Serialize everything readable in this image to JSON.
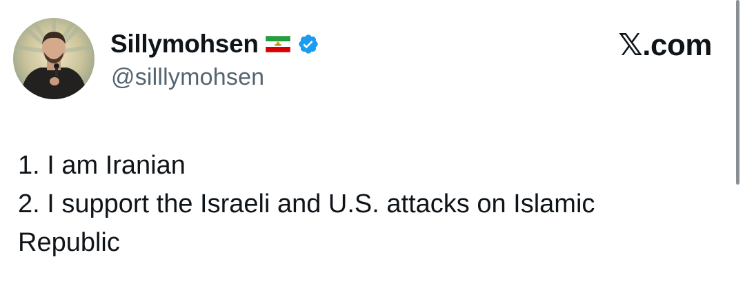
{
  "author": {
    "display_name": "Sillymohsen",
    "handle": "@silllymohsen",
    "flag_icon": "iran-lion-and-sun-flag-icon",
    "verified_icon": "verified-badge-icon",
    "verified_color": "#1d9bf0"
  },
  "brand": {
    "glyph": "𝕏",
    "suffix": ".com"
  },
  "tweet": {
    "lines": [
      "1. I am Iranian",
      "2. I support the Israeli and U.S. attacks on Islamic",
      "Republic"
    ]
  },
  "colors": {
    "text": "#0f1419",
    "handle": "#536471",
    "scrollbar": "#8a8f94"
  }
}
